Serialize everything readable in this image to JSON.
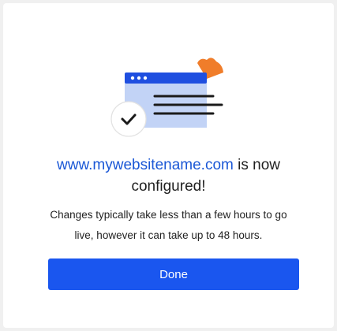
{
  "dialog": {
    "illustration_icon": "website-configured-illustration",
    "check_icon": "checkmark-icon",
    "headline": {
      "domain": "www.mywebsitename.com",
      "suffix_line1": " is now",
      "line2": "configured!"
    },
    "message_line1": "Changes typically take less than a few hours to go",
    "message_line2": "live, however it can take up to 48 hours.",
    "done_label": "Done"
  },
  "colors": {
    "accent": "#1a56ef",
    "domain_link": "#1a57d6",
    "browser_bar": "#1f4fe0",
    "browser_body": "#c2d3f6",
    "decoration": "#f07d2a"
  }
}
